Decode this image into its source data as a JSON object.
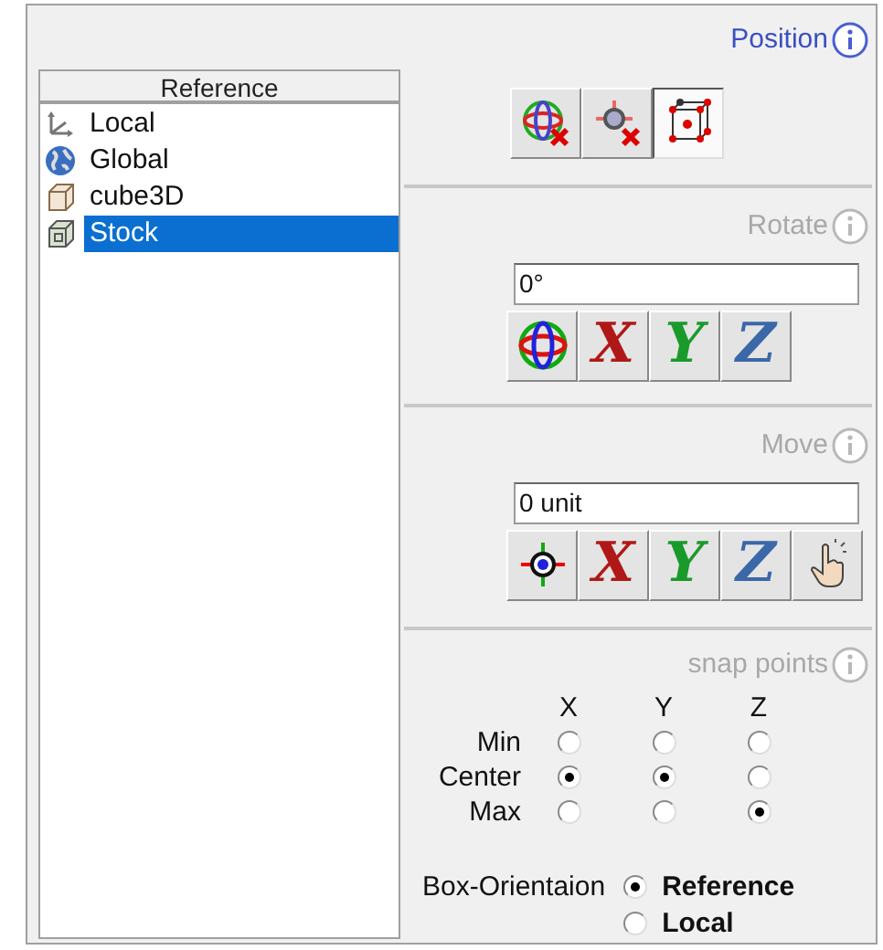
{
  "reference": {
    "header": "Reference",
    "items": [
      {
        "label": "Local",
        "selected": false
      },
      {
        "label": "Global",
        "selected": false
      },
      {
        "label": "cube3D",
        "selected": false
      },
      {
        "label": "Stock",
        "selected": true
      }
    ]
  },
  "sections": [
    {
      "title": "Position",
      "active": true,
      "buttons": [
        {
          "kind": "icon",
          "selected": false
        },
        {
          "kind": "icon",
          "selected": false
        },
        {
          "kind": "icon",
          "selected": true
        }
      ]
    },
    {
      "title": "Rotate",
      "active": false,
      "value": "0°",
      "buttons": [
        {
          "kind": "icon",
          "selected": false
        },
        {
          "kind": "letter",
          "label": "X",
          "color": "#b01818",
          "selected": false
        },
        {
          "kind": "letter",
          "label": "Y",
          "color": "#1a9a2a",
          "selected": false
        },
        {
          "kind": "letter",
          "label": "Z",
          "color": "#3a68a8",
          "selected": false
        }
      ]
    },
    {
      "title": "Move",
      "active": false,
      "value": "0 unit",
      "buttons": [
        {
          "kind": "icon",
          "selected": false
        },
        {
          "kind": "letter",
          "label": "X",
          "color": "#b01818",
          "selected": false
        },
        {
          "kind": "letter",
          "label": "Y",
          "color": "#1a9a2a",
          "selected": false
        },
        {
          "kind": "letter",
          "label": "Z",
          "color": "#3a68a8",
          "selected": false
        },
        {
          "kind": "icon",
          "selected": false
        }
      ]
    }
  ],
  "snap_points": {
    "title": "snap points",
    "active": false,
    "columns": [
      "X",
      "Y",
      "Z"
    ],
    "rows": [
      {
        "label": "Min",
        "options": [
          {
            "checked": false
          },
          {
            "checked": false
          },
          {
            "checked": false
          }
        ]
      },
      {
        "label": "Center",
        "options": [
          {
            "checked": true
          },
          {
            "checked": true
          },
          {
            "checked": false
          }
        ]
      },
      {
        "label": "Max",
        "options": [
          {
            "checked": false
          },
          {
            "checked": false
          },
          {
            "checked": true
          }
        ]
      }
    ]
  },
  "box_orientation": {
    "label": "Box-Orientaion",
    "options": [
      {
        "label": "Reference",
        "selected": true
      },
      {
        "label": "Local",
        "selected": false
      }
    ]
  }
}
